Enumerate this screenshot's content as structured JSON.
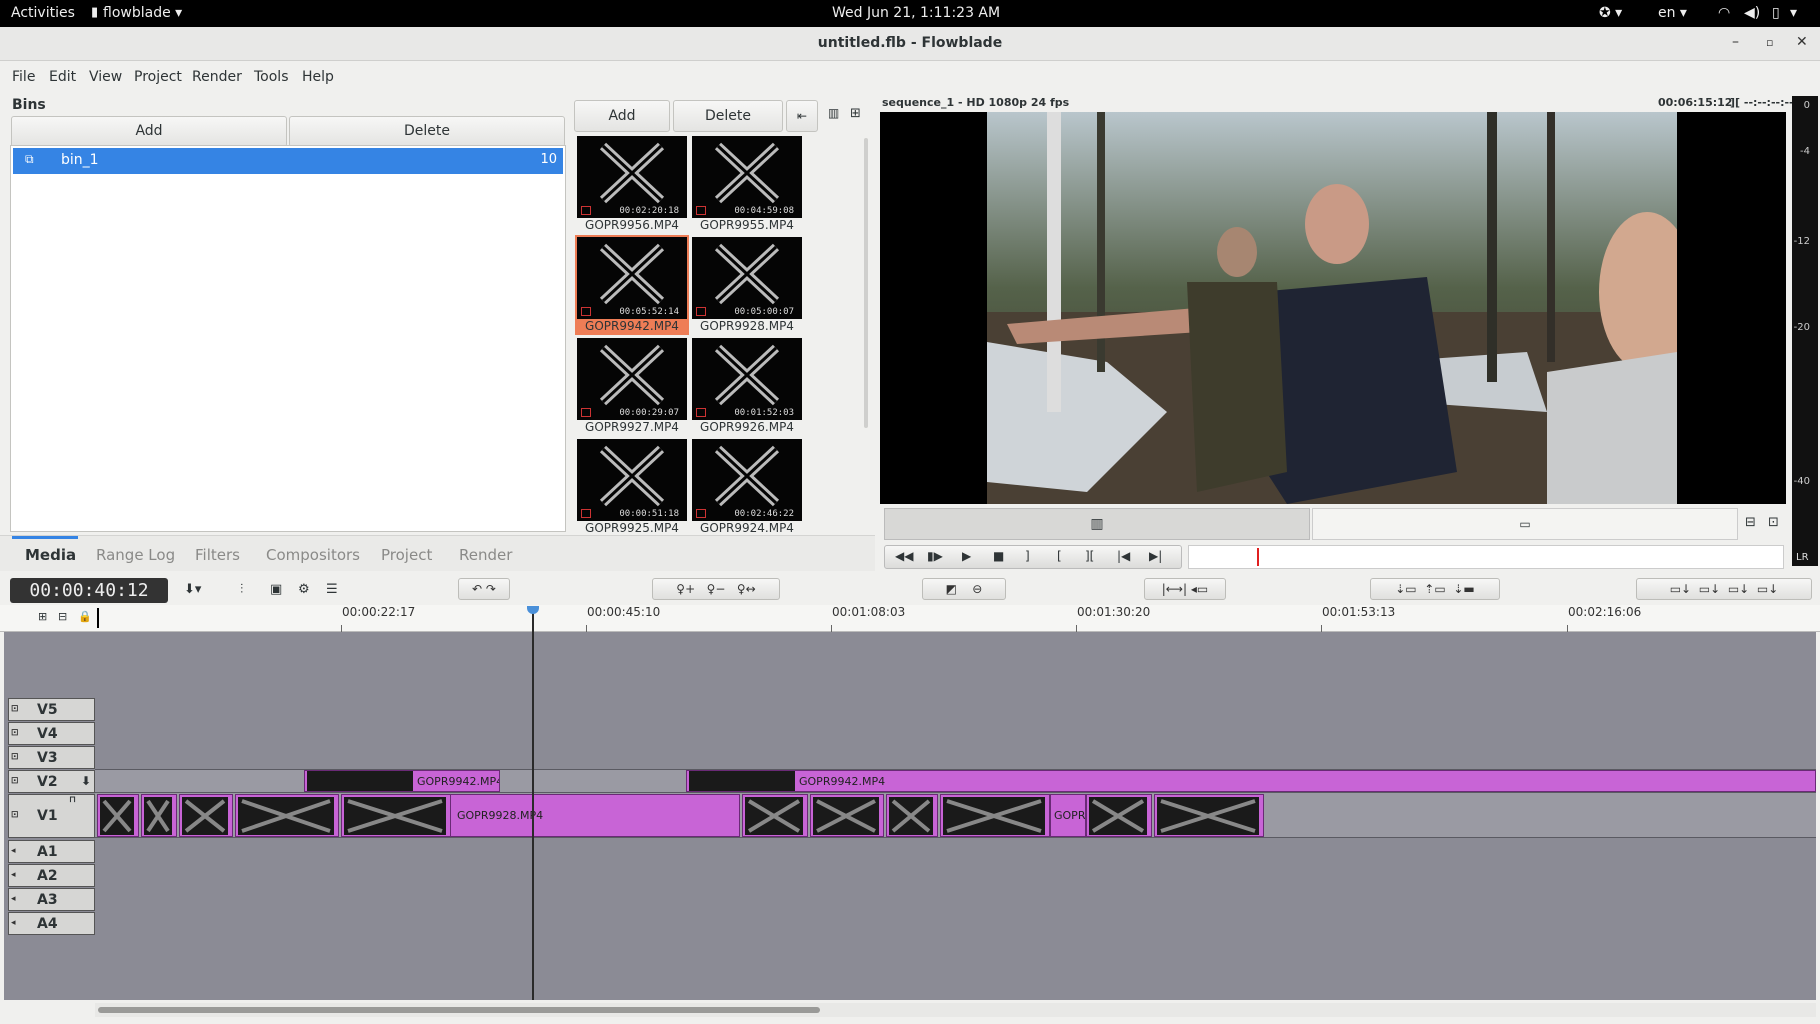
{
  "topbar": {
    "activities": "Activities",
    "app_name": "flowblade ▾",
    "clock": "Wed Jun 21,  1:11:23 AM",
    "lang": "en ▾"
  },
  "window": {
    "title": "untitled.flb - Flowblade"
  },
  "menu": [
    "File",
    "Edit",
    "View",
    "Project",
    "Render",
    "Tools",
    "Help"
  ],
  "bins": {
    "header": "Bins",
    "add_label": "Add",
    "delete_label": "Delete",
    "items": [
      {
        "name": "bin_1",
        "count": "10"
      }
    ]
  },
  "media": {
    "add_label": "Add",
    "delete_label": "Delete",
    "items": [
      {
        "name": "GOPR9956.MP4",
        "duration": "00:02:20:18"
      },
      {
        "name": "GOPR9955.MP4",
        "duration": "00:04:59:08"
      },
      {
        "name": "GOPR9942.MP4",
        "duration": "00:05:52:14"
      },
      {
        "name": "GOPR9928.MP4",
        "duration": "00:05:00:07"
      },
      {
        "name": "GOPR9927.MP4",
        "duration": "00:00:29:07"
      },
      {
        "name": "GOPR9926.MP4",
        "duration": "00:01:52:03"
      },
      {
        "name": "GOPR9925.MP4",
        "duration": "00:00:51:18"
      },
      {
        "name": "GOPR9924.MP4",
        "duration": "00:02:46:22"
      }
    ]
  },
  "tabs": [
    "Media",
    "Range Log",
    "Filters",
    "Compositors",
    "Project",
    "Render"
  ],
  "monitor": {
    "sequence_info": "sequence_1  -  HD 1080p 24 fps",
    "timecode": "00:06:15:12",
    "mark_info": "][ --:--:--:--",
    "meter_labels": [
      "0",
      "-4",
      "-12",
      "-20",
      "-40"
    ],
    "meter_lr": "LR"
  },
  "timeline": {
    "timecode": "00:00:40:12",
    "ruler_labels": [
      "00:00:22:17",
      "00:00:45:10",
      "00:01:08:03",
      "00:01:30:20",
      "00:01:53:13",
      "00:02:16:06"
    ],
    "tracks": [
      "V5",
      "V4",
      "V3",
      "V2",
      "V1",
      "A1",
      "A2",
      "A3",
      "A4"
    ],
    "clips": {
      "v2_a": "GOPR9942.MP4",
      "v2_b": "GOPR9942.MP4",
      "v1_main": "GOPR9928.MP4",
      "v1_short": "GOPR"
    }
  },
  "colors": {
    "selection_blue": "#3584e4",
    "clip_purple": "#c864d6",
    "selected_thumb": "#ee7d56",
    "timeline_bg": "#8b8b95"
  }
}
